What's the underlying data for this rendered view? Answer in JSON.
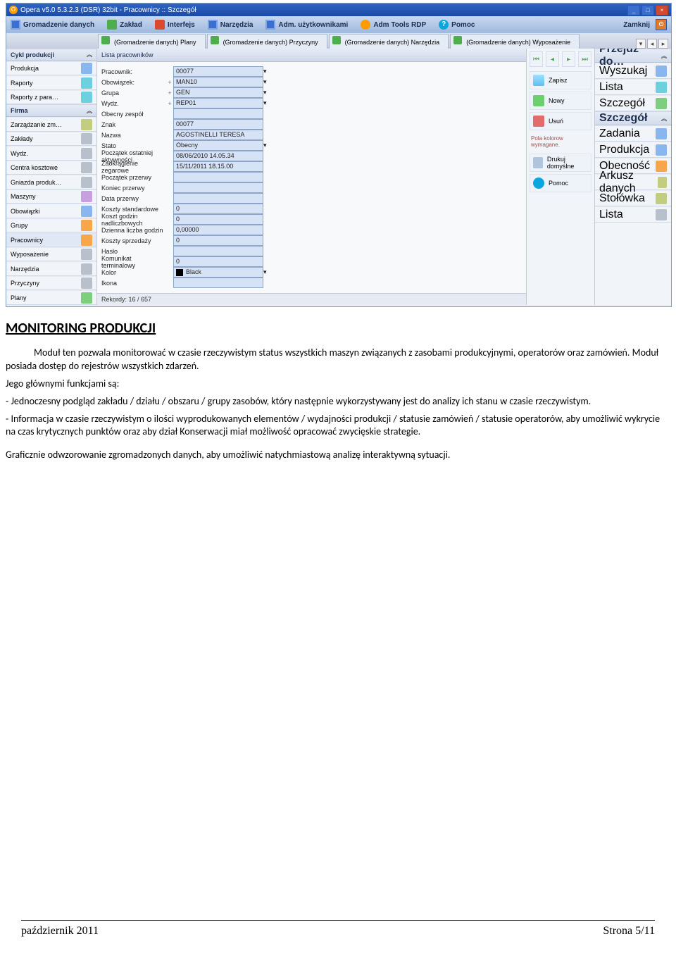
{
  "titlebar": {
    "title": "Opera v5.0 5.3.2.3 (DSR) 32bit - Pracownicy :: Szczegół"
  },
  "menu": {
    "items": [
      {
        "label": "Gromadzenie danych"
      },
      {
        "label": "Zakład"
      },
      {
        "label": "Interfejs"
      },
      {
        "label": "Narzędzia"
      },
      {
        "label": "Adm. użytkownikami"
      },
      {
        "label": "Adm Tools RDP"
      },
      {
        "label": "Pomoc"
      }
    ],
    "closeLabel": "Zamknij"
  },
  "tabs": {
    "items": [
      {
        "label": "(Gromadzenie danych) Plany"
      },
      {
        "label": "(Gromadzenie danych) Przyczyny"
      },
      {
        "label": "(Gromadzenie danych) Narzędzia"
      },
      {
        "label": "(Gromadzenie danych) Wyposażenie"
      }
    ]
  },
  "leftnav": {
    "sections": [
      {
        "title": "Cykl produkcji",
        "items": [
          "Produkcja",
          "Raporty",
          "Raporty z para…"
        ]
      },
      {
        "title": "Firma",
        "items": [
          "Zarządzanie zm…",
          "Zakłady",
          "Wydz.",
          "Centra kosztowe",
          "Gniazda produk…",
          "Maszyny",
          "Obowiązki",
          "Grupy",
          "Pracownicy",
          "Wyposażenie",
          "Narzędzia",
          "Przyczyny",
          "Plany"
        ]
      }
    ]
  },
  "center": {
    "listTitle": "Lista pracowników",
    "records": "Rekordy: 16 / 657",
    "fields": [
      {
        "label": "Pracownik:",
        "value": "00077",
        "combo": true
      },
      {
        "label": "Obowiązek:",
        "value": "MAN10",
        "combo": true,
        "plus": true
      },
      {
        "label": "Grupa",
        "value": "GEN",
        "combo": true,
        "plus": true
      },
      {
        "label": "Wydz.",
        "value": "REP01",
        "combo": true,
        "plus": true
      },
      {
        "label": "Obecny zespół",
        "value": ""
      },
      {
        "label": "Znak",
        "value": "00077"
      },
      {
        "label": "Nazwa",
        "value": "AGOSTINELLI TERESA"
      },
      {
        "label": "Stato",
        "value": "Obecny",
        "combo": true
      },
      {
        "label": "Początek ostatniej aktywności",
        "value": "08/06/2010 14.05.34"
      },
      {
        "label": "Zaokrąglenie zegarowe",
        "value": "15/11/2011 18.15.00"
      },
      {
        "label": "Początek przerwy",
        "value": ""
      },
      {
        "label": "Koniec przerwy",
        "value": ""
      },
      {
        "label": "Data przerwy",
        "value": ""
      },
      {
        "label": "Koszty standardowe",
        "value": "0"
      },
      {
        "label": "Koszt godzin nadliczbowych",
        "value": "0"
      },
      {
        "label": "Dzienna liczba godzin",
        "value": "0,00000"
      },
      {
        "label": "Koszty sprzedaży",
        "value": "0"
      },
      {
        "label": "Hasło",
        "value": ""
      },
      {
        "label": "Komunikat terminalowy",
        "value": "0"
      },
      {
        "label": "Kolor",
        "value": "Black",
        "combo": true,
        "color": true
      },
      {
        "label": "Ikona",
        "value": ""
      }
    ]
  },
  "sidepanel": {
    "zapisz": "Zapisz",
    "nowy": "Nowy",
    "usun": "Usuń",
    "pola": "Pola kolorow wymagane.",
    "drukuj": "Drukuj domyślne",
    "pomoc": "Pomoc"
  },
  "rightnav": {
    "sections": [
      {
        "title": "Przejdź do…",
        "items": [
          "Wyszukaj",
          "Lista",
          "Szczegół"
        ]
      },
      {
        "title": "Szczegół",
        "items": [
          "Zadania",
          "Produkcja",
          "Obecność",
          "Arkusz danych",
          "Stołówka",
          "Lista"
        ]
      }
    ]
  },
  "article": {
    "heading": "MONITORING PRODUKCJI",
    "p1": "Moduł ten pozwala monitorować w czasie rzeczywistym status wszystkich maszyn związanych z zasobami produkcyjnymi, operatorów oraz zamówień. Moduł posiada dostęp do rejestrów wszystkich zdarzeń.",
    "p2": "Jego głównymi funkcjami są:",
    "p3": "- Jednoczesny podgląd zakładu / działu / obszaru / grupy zasobów, który następnie wykorzystywany jest do analizy ich stanu w czasie rzeczywistym.",
    "p4": "- Informacja w czasie rzeczywistym o ilości wyprodukowanych elementów / wydajności produkcji / statusie zamówień / statusie operatorów, aby umożliwić wykrycie na czas krytycznych punktów oraz aby dział Konserwacji miał możliwość opracować zwycięskie strategie.",
    "p5": "Graficznie odwzorowanie zgromadzonych danych, aby umożliwić natychmiastową analizę interaktywną sytuacji."
  },
  "footer": {
    "left": "październik 2011",
    "right": "Strona 5/11"
  }
}
